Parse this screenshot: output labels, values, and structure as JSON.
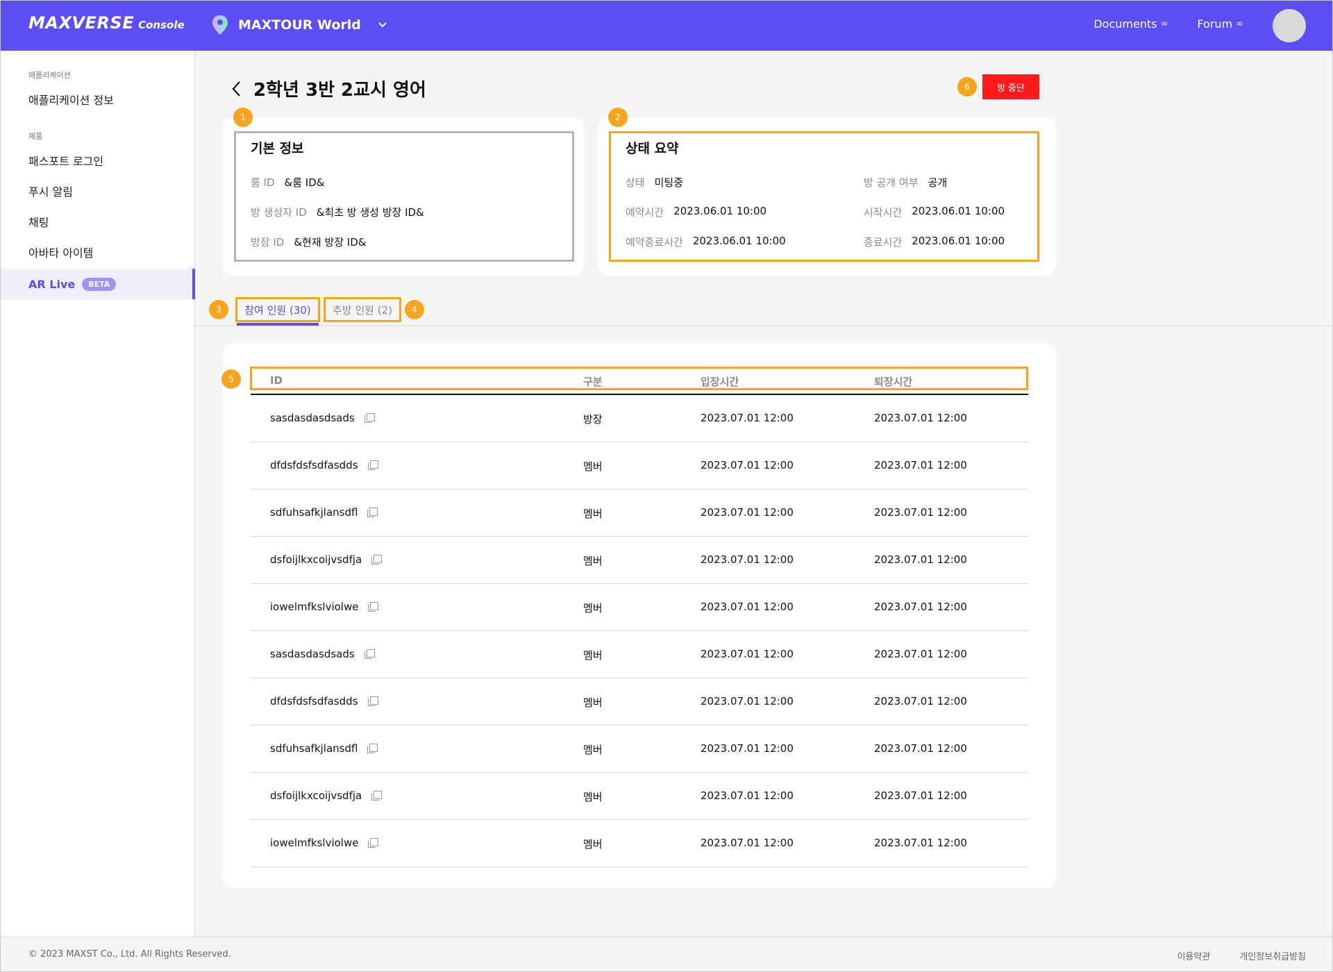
{
  "header": {
    "logo": "MAXVERSE",
    "logo_sub": "Console",
    "project_name": "MAXTOUR World",
    "links": [
      {
        "label": "Documents"
      },
      {
        "label": "Forum"
      }
    ]
  },
  "sidebar": {
    "section_app": "애플리케이션",
    "item_app_info": "애플리케이션 정보",
    "section_product": "제품",
    "items": [
      {
        "label": "패스포트 로그인"
      },
      {
        "label": "푸시 알림"
      },
      {
        "label": "채팅"
      },
      {
        "label": "아바타 아이템"
      },
      {
        "label": "AR Live",
        "badge": "BETA"
      }
    ]
  },
  "page": {
    "title": "2학년 3반 2교시 영어",
    "stop_button": "방 중단"
  },
  "badges": [
    "1",
    "2",
    "3",
    "4",
    "5",
    "6"
  ],
  "basic_info": {
    "title": "기본 정보",
    "fields": [
      {
        "label": "룸 ID",
        "value": "&룸 ID&"
      },
      {
        "label": "방 생성자 ID",
        "value": "&최초 방 생성 방장 ID&"
      },
      {
        "label": "방장 ID",
        "value": "&현재 방장 ID&"
      }
    ]
  },
  "status_summary": {
    "title": "상태 요약",
    "fields": [
      {
        "label": "상태",
        "value": "미팅중"
      },
      {
        "label": "방 공개 여부",
        "value": "공개"
      },
      {
        "label": "예약시간",
        "value": "2023.06.01 10:00"
      },
      {
        "label": "시작시간",
        "value": "2023.06.01 10:00"
      },
      {
        "label": "예약종료시간",
        "value": "2023.06.01 10:00"
      },
      {
        "label": "종료시간",
        "value": "2023.06.01 10:00"
      }
    ]
  },
  "tabs": [
    {
      "label": "참여 인원 (30)",
      "active": true
    },
    {
      "label": "추방 인원 (2)",
      "active": false
    }
  ],
  "table": {
    "headers": [
      "ID",
      "구분",
      "입장시간",
      "퇴장시간"
    ],
    "rows": [
      [
        "sasdasdasdsads",
        "방장",
        "2023.07.01  12:00",
        "2023.07.01  12:00"
      ],
      [
        "dfdsfdsfsdfasdds",
        "멤버",
        "2023.07.01  12:00",
        "2023.07.01  12:00"
      ],
      [
        "sdfuhsafkjlansdfl",
        "멤버",
        "2023.07.01  12:00",
        "2023.07.01  12:00"
      ],
      [
        "dsfoijlkxcoijvsdfja",
        "멤버",
        "2023.07.01  12:00",
        "2023.07.01  12:00"
      ],
      [
        "iowelmfkslviolwe",
        "멤버",
        "2023.07.01  12:00",
        "2023.07.01  12:00"
      ],
      [
        "sasdasdasdsads",
        "멤버",
        "2023.07.01  12:00",
        "2023.07.01  12:00"
      ],
      [
        "dfdsfdsfsdfasdds",
        "멤버",
        "2023.07.01  12:00",
        "2023.07.01  12:00"
      ],
      [
        "sdfuhsafkjlansdfl",
        "멤버",
        "2023.07.01  12:00",
        "2023.07.01  12:00"
      ],
      [
        "dsfoijlkxcoijvsdfja",
        "멤버",
        "2023.07.01  12:00",
        "2023.07.01  12:00"
      ],
      [
        "iowelmfkslviolwe",
        "멤버",
        "2023.07.01  12:00",
        "2023.07.01  12:00"
      ]
    ]
  },
  "footer": {
    "copyright": "© 2023 MAXST Co., Ltd. All Rights Reserved.",
    "links": [
      "이용약관",
      "개인정보취급방침"
    ]
  },
  "colors": {
    "brand": "#5b4ef5",
    "annotation": "#f7a51f",
    "danger": "#ff1b1b",
    "info_box_border": "#b5b5b5"
  }
}
